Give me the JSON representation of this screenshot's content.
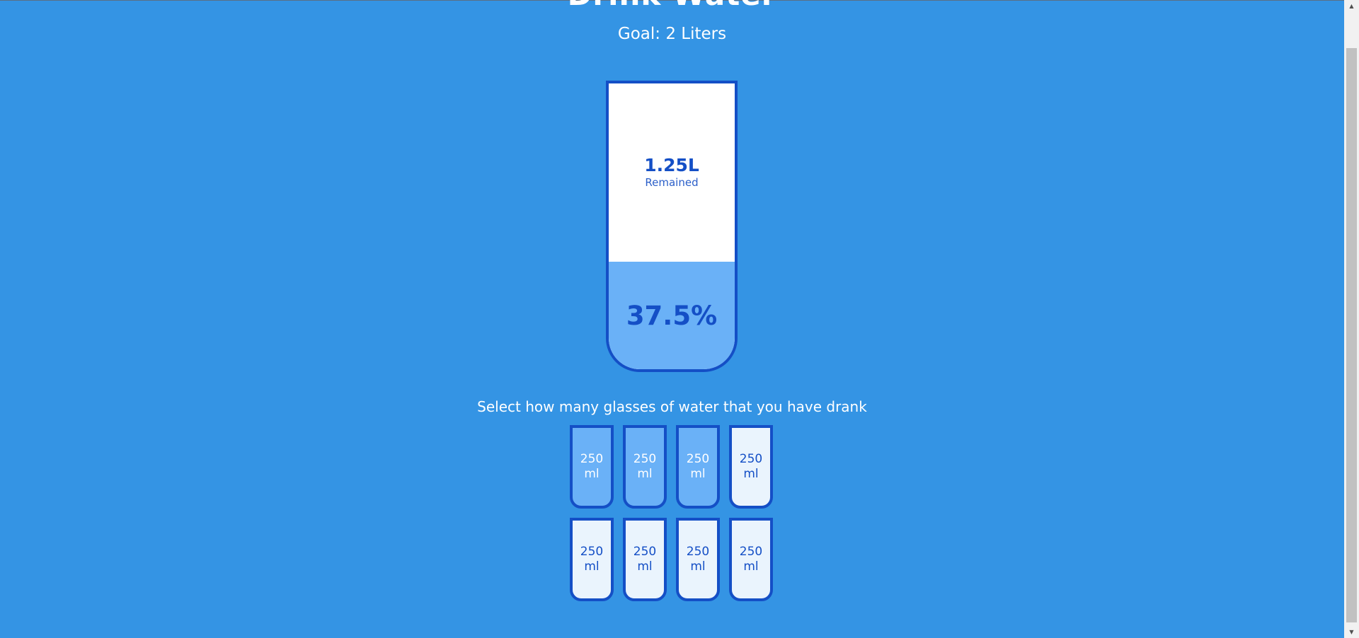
{
  "header": {
    "title": "Drink Water",
    "goal": "Goal: 2 Liters"
  },
  "big_cup": {
    "remained_amount": "1.25L",
    "remained_label": "Remained",
    "percentage_text": "37.5%",
    "fill_fraction": 0.375
  },
  "instruction": "Select how many glasses of water that you have drank",
  "cups": [
    {
      "amount": "250",
      "unit": "ml",
      "full": true
    },
    {
      "amount": "250",
      "unit": "ml",
      "full": true
    },
    {
      "amount": "250",
      "unit": "ml",
      "full": true
    },
    {
      "amount": "250",
      "unit": "ml",
      "full": false
    },
    {
      "amount": "250",
      "unit": "ml",
      "full": false
    },
    {
      "amount": "250",
      "unit": "ml",
      "full": false
    },
    {
      "amount": "250",
      "unit": "ml",
      "full": false
    },
    {
      "amount": "250",
      "unit": "ml",
      "full": false
    }
  ],
  "colors": {
    "background": "#3494e4",
    "accent": "#144fc6",
    "water": "#6ab1f7",
    "empty_cup": "#eaf4fd"
  },
  "scrollbar": {
    "up_icon": "arrow-up-icon",
    "down_icon": "arrow-down-icon"
  }
}
